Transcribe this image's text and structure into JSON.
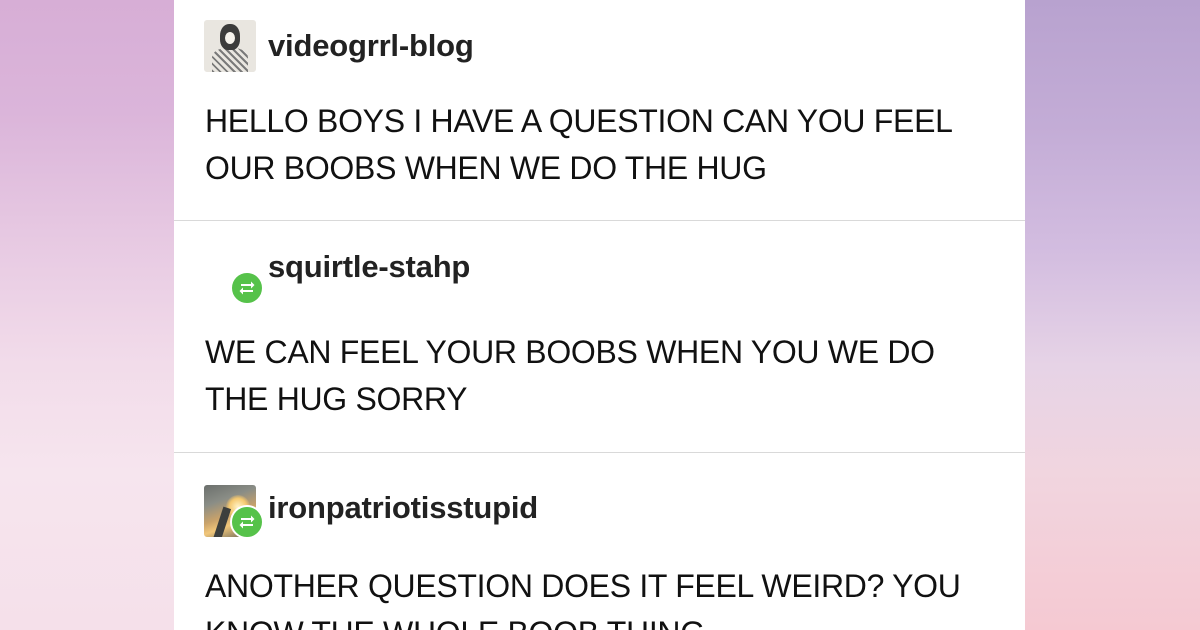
{
  "posts": [
    {
      "username": "videogrrl-blog",
      "avatar": "sketch-avatar",
      "reblogged": false,
      "text": "HELLO BOYS I HAVE A QUESTION CAN YOU FEEL OUR BOOBS WHEN WE DO THE HUG"
    },
    {
      "username": "squirtle-stahp",
      "avatar": "none",
      "reblogged": true,
      "text": "WE CAN FEEL YOUR BOOBS WHEN YOU WE DO THE HUG SORRY"
    },
    {
      "username": "ironpatriotisstupid",
      "avatar": "road-sunset-avatar",
      "reblogged": true,
      "text": "ANOTHER QUESTION DOES IT FEEL WEIRD? YOU KNOW THE WHOLE BOOB THING"
    }
  ],
  "icons": {
    "reblog": "reblog-icon"
  },
  "colors": {
    "reblog_badge": "#56c24a",
    "text": "#111111",
    "divider": "#d9d9d9"
  }
}
